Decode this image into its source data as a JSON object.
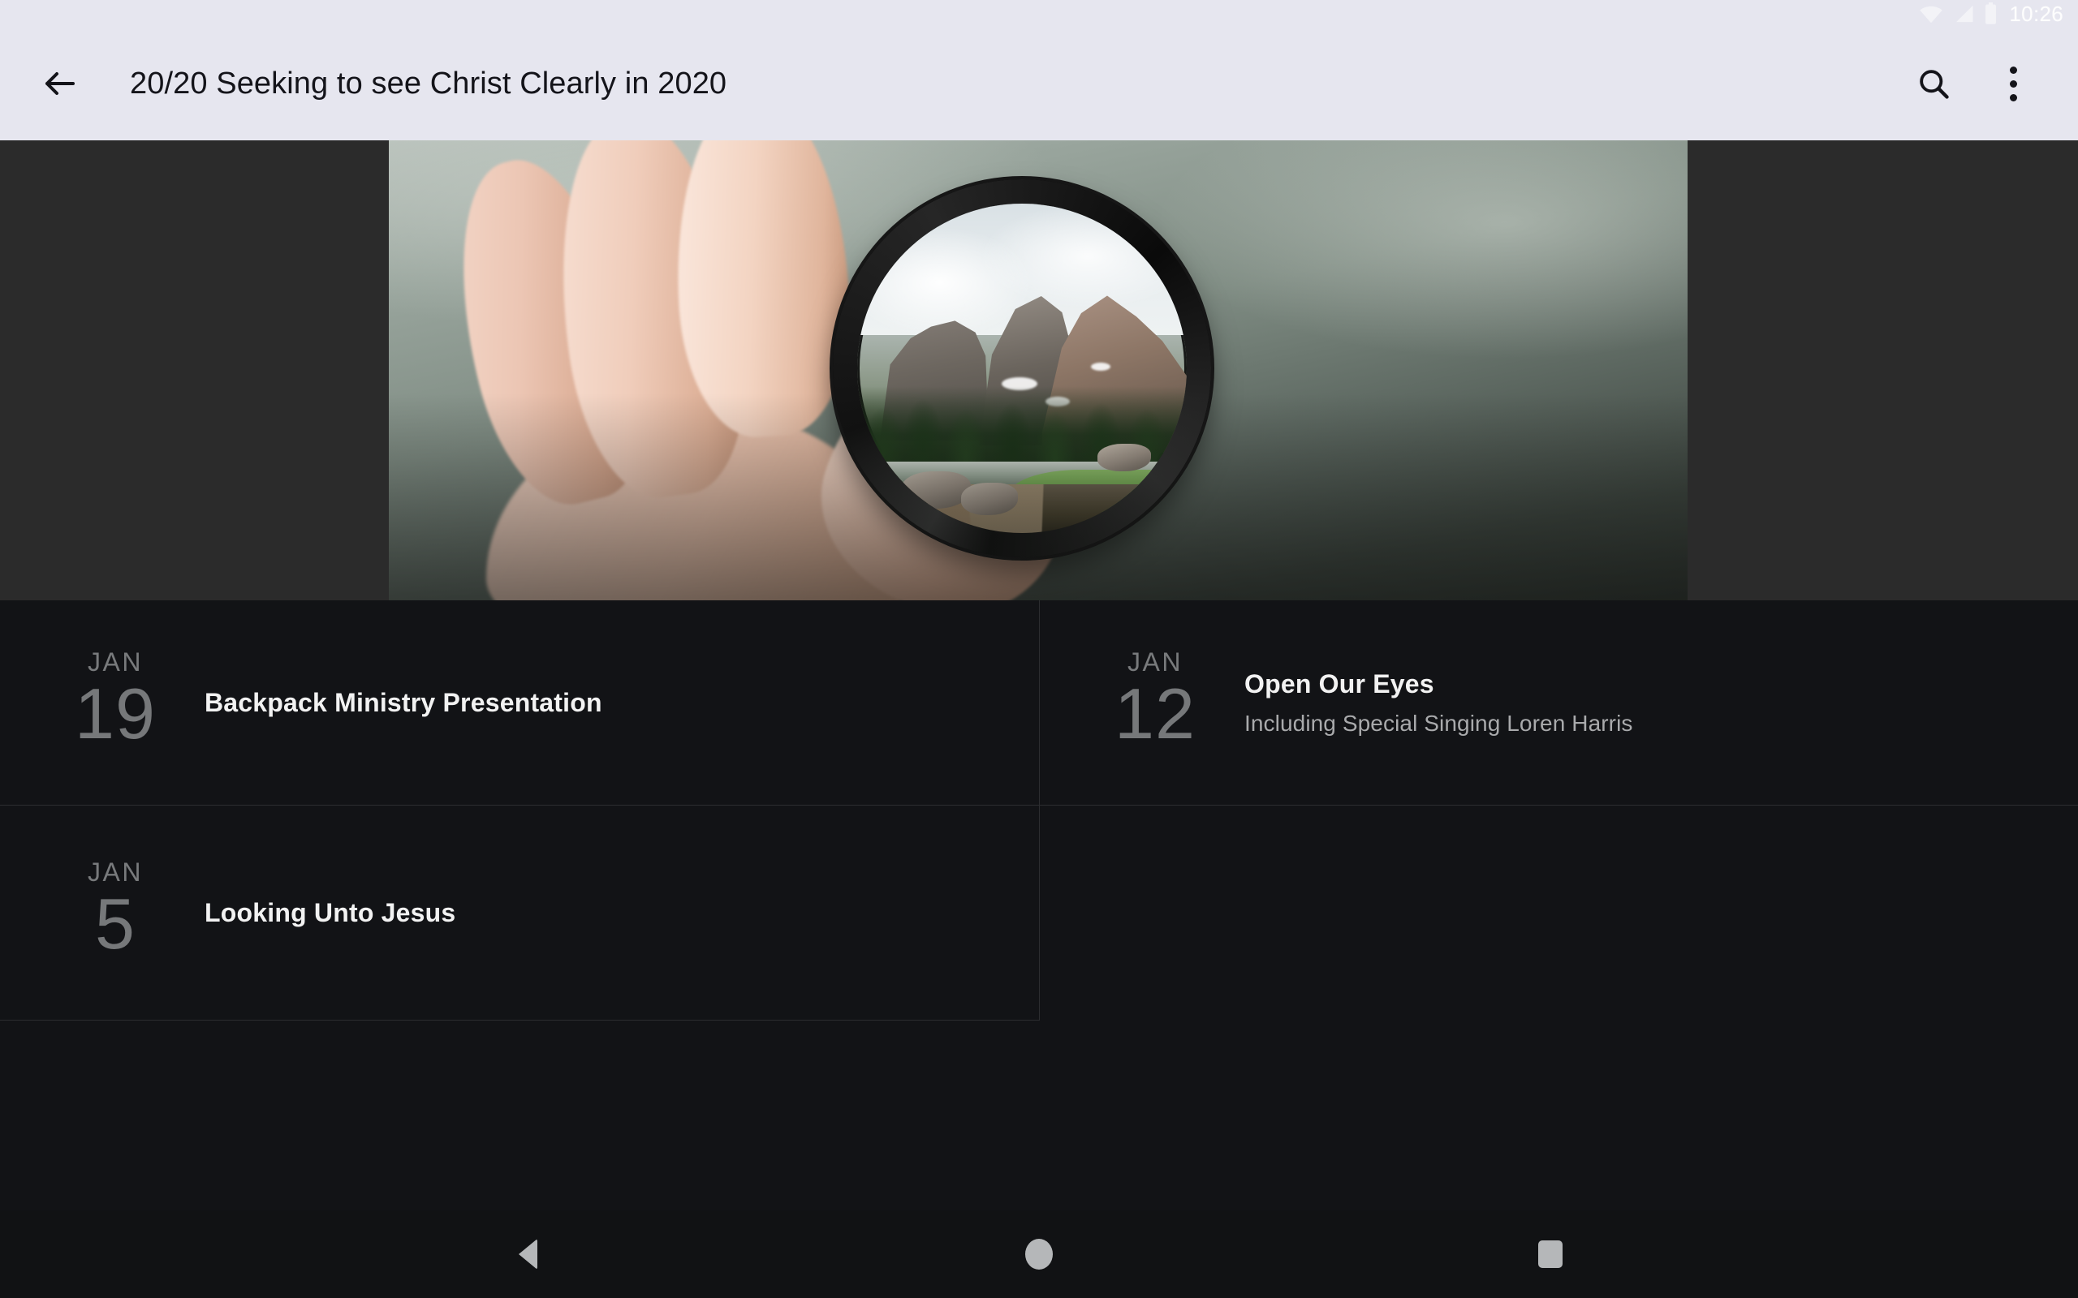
{
  "statusbar": {
    "time": "10:26",
    "icons": [
      "wifi-icon",
      "cellular-signal-icon",
      "battery-icon"
    ]
  },
  "appbar": {
    "back_icon": "back-arrow-icon",
    "title": "20/20 Seeking to see Christ Clearly in 2020",
    "search_icon": "search-icon",
    "overflow_icon": "overflow-menu-icon",
    "background_color": "#e6e6ef",
    "text_color": "#14141a"
  },
  "hero": {
    "alt": "Hand holding a camera lens filter showing a mountain lake landscape",
    "band_color": "#2b2b2b"
  },
  "sermons": [
    {
      "month": "JAN",
      "day": "19",
      "title": "Backpack Ministry Presentation",
      "subtitle": ""
    },
    {
      "month": "JAN",
      "day": "12",
      "title": "Open Our Eyes",
      "subtitle": "Including Special Singing Loren Harris"
    },
    {
      "month": "JAN",
      "day": "5",
      "title": "Looking Unto Jesus",
      "subtitle": ""
    }
  ],
  "navbar": {
    "back_label": "back-nav-button",
    "home_label": "home-nav-button",
    "recents_label": "recents-nav-button"
  },
  "colors": {
    "page_background": "#121316",
    "divider": "#2c2d30",
    "title_text": "#f2f2f2",
    "subtitle_text": "#a9aaac",
    "date_text": "#7b7c7e"
  }
}
